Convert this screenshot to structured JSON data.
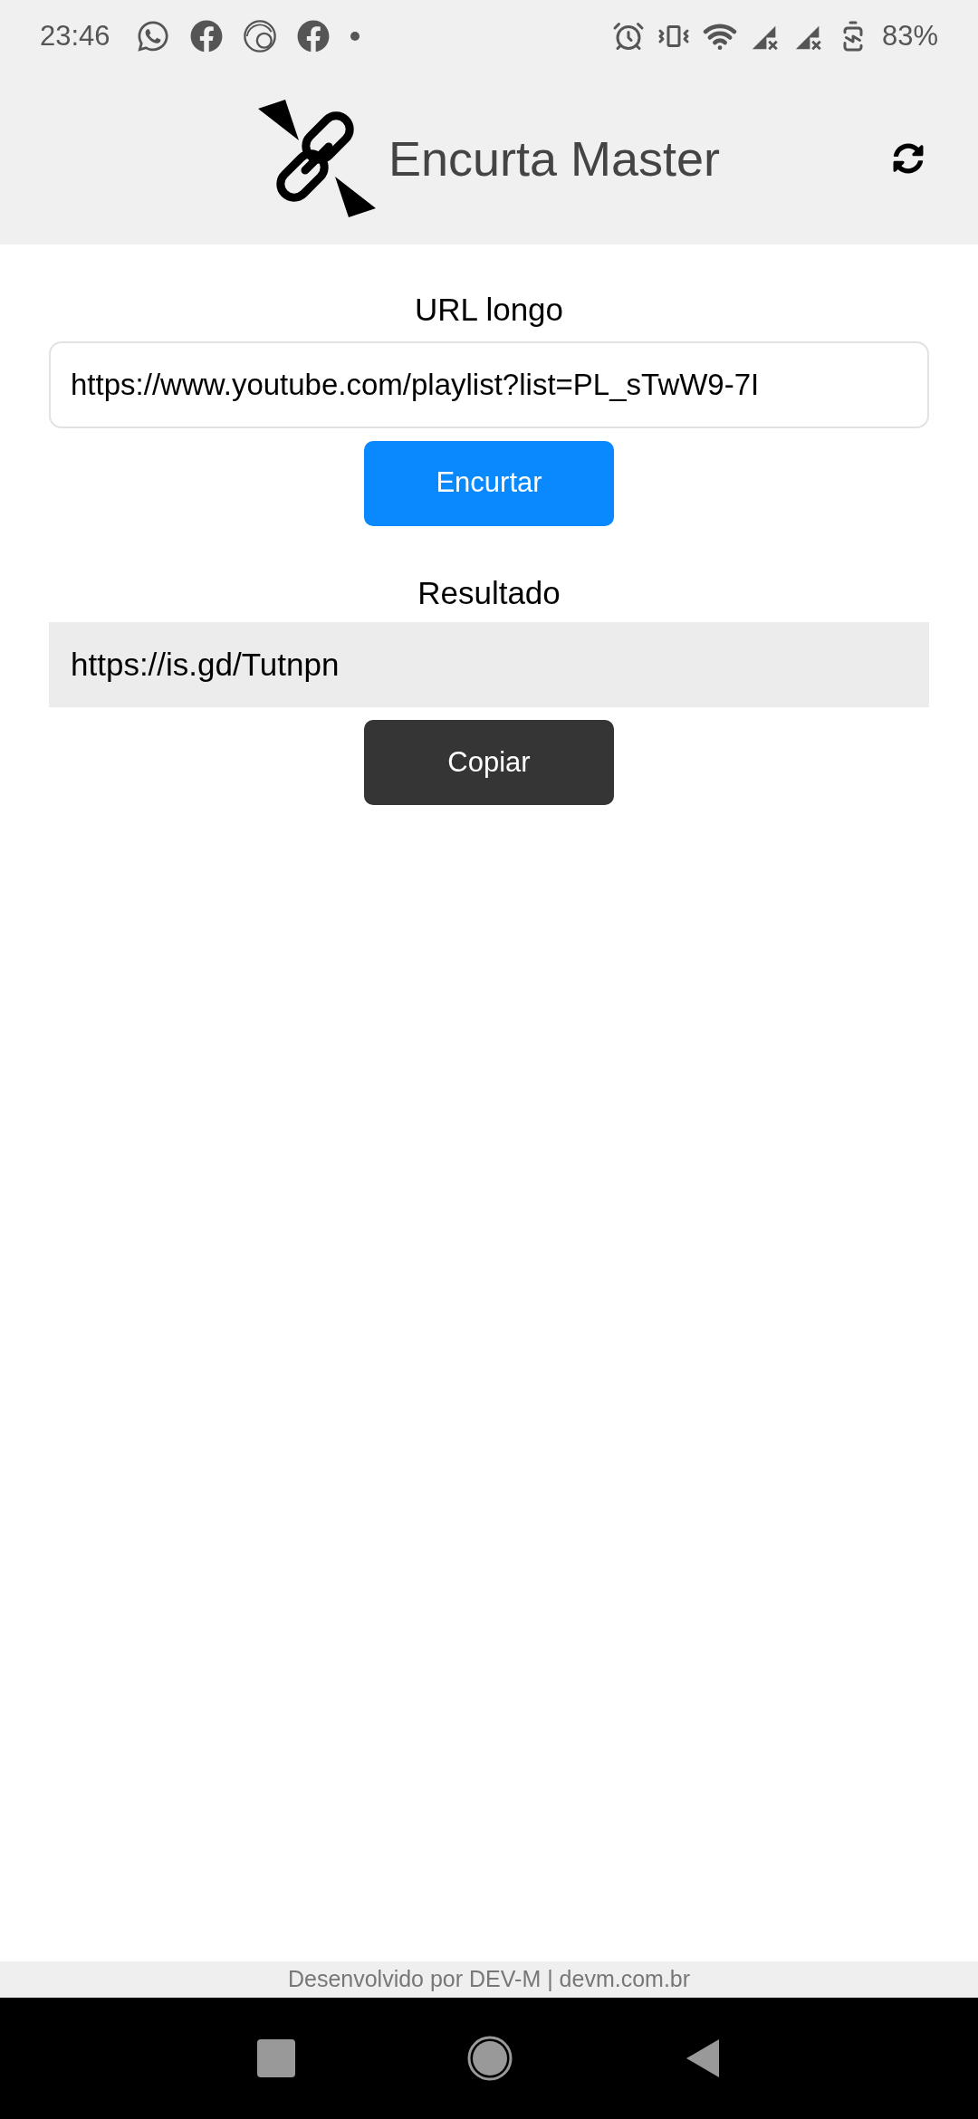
{
  "status_bar": {
    "time": "23:46",
    "battery": "83%"
  },
  "header": {
    "title": "Encurta Master"
  },
  "form": {
    "label": "URL longo",
    "value": "https://www.youtube.com/playlist?list=PL_sTwW9-7I",
    "button": "Encurtar"
  },
  "result": {
    "label": "Resultado",
    "value": "https://is.gd/Tutnpn",
    "button": "Copiar"
  },
  "footer": {
    "text": "Desenvolvido por DEV-M | devm.com.br"
  }
}
